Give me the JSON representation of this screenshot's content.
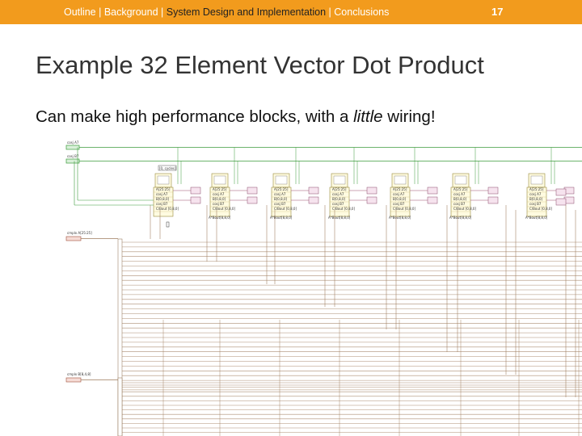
{
  "header": {
    "crumbs": [
      {
        "label": "Outline",
        "active": false
      },
      {
        "label": "Background",
        "active": false
      },
      {
        "label": "System Design and Implementation",
        "active": true
      },
      {
        "label": "Conclusions",
        "active": false
      }
    ],
    "separator": " | ",
    "slide_number": "17",
    "accent": "#f29b1d"
  },
  "slide": {
    "title": "Example 32 Element Vector Dot Product",
    "subtitle_before": "Can make high performance blocks, with a ",
    "subtitle_emph": "little",
    "subtitle_after": " wiring!"
  },
  "diagram": {
    "controls": {
      "top": [
        "cosj A7",
        "cosj B7"
      ],
      "side": [
        "cmplx A[25:25]",
        "cmplx B[8,4,8]"
      ]
    },
    "loop_label": "[0, cycles]",
    "block_lines": [
      "A[25:25]",
      "cosj A7",
      "B[0,8,0]",
      "cosj B7",
      "C/Bout [0,8,0]"
    ],
    "output_label": "A*Bout[8,8,0]",
    "wire_color": "#9e7b5c",
    "ctrl_color": "#3d9b3d"
  }
}
